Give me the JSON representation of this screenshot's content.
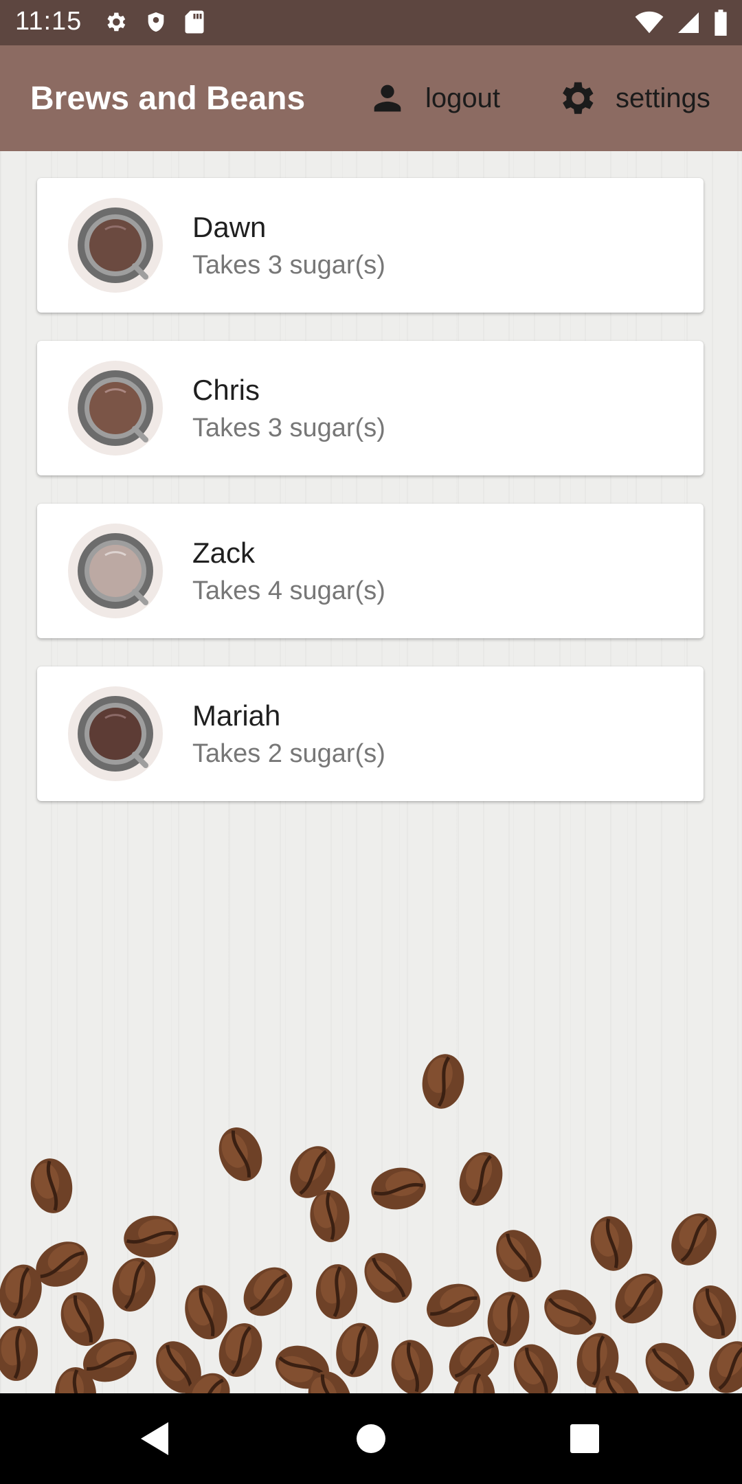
{
  "status_bar": {
    "time": "11:15",
    "left_icons": [
      "gear-icon",
      "shield-icon",
      "sd-card-icon"
    ],
    "right_icons": [
      "wifi-icon",
      "signal-icon",
      "battery-icon"
    ]
  },
  "app_bar": {
    "title": "Brews and Beans",
    "logout_label": "logout",
    "logout_icon": "person-icon",
    "settings_label": "settings",
    "settings_icon": "gear-icon",
    "background_color": "#8c6b62"
  },
  "brews": [
    {
      "name": "Dawn",
      "subtitle": "Takes 3 sugar(s)",
      "coffee_color": "#6b4a40"
    },
    {
      "name": "Chris",
      "subtitle": "Takes 3 sugar(s)",
      "coffee_color": "#7b5547"
    },
    {
      "name": "Zack",
      "subtitle": "Takes 4 sugar(s)",
      "coffee_color": "#bca9a3"
    },
    {
      "name": "Mariah",
      "subtitle": "Takes 2 sugar(s)",
      "coffee_color": "#5d3c35"
    }
  ],
  "nav_bar": {
    "buttons": [
      "back-icon",
      "home-icon",
      "recents-icon"
    ]
  }
}
